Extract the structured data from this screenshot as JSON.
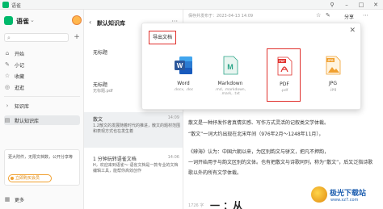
{
  "window": {
    "title": "语雀",
    "controls": [
      "⚲",
      "–",
      "□",
      "✕"
    ]
  },
  "sidebar": {
    "brand": "语雀",
    "brand_caret": "⌄",
    "search_icon": "search-icon",
    "add_label": "+",
    "nav": [
      {
        "label": "开始",
        "icon": "home-icon"
      },
      {
        "label": "小记",
        "icon": "note-icon"
      },
      {
        "label": "收藏",
        "icon": "star-icon"
      },
      {
        "label": "逛逛",
        "icon": "compass-icon"
      }
    ],
    "kb_section": "知识库",
    "kb_item": "默认知识库",
    "promo_text": "更大附件，无限文档数，公开分享等",
    "promo_button": "立即购买会员",
    "more": "更多"
  },
  "doclist": {
    "title": "默认知识库",
    "back": "‹",
    "dots": "···",
    "items": [
      {
        "title": "无标题",
        "sub": "",
        "time": "",
        "preview": ""
      },
      {
        "title": "无标题",
        "sub": "无标题.pdf",
        "time": "",
        "preview": ""
      },
      {
        "title": "散文",
        "sub": "",
        "time": "14:09",
        "preview": "1.2散文的发展随着时代的推进，散文的题材范围和表现方式也在发生着"
      },
      {
        "title": "1 分钟玩转语雀文档",
        "sub": "",
        "time": "14:06",
        "preview": "H，欢迎来到语雀～ 语雀文档是一款专业的文档编辑工具，能帮你高效创作"
      }
    ]
  },
  "editor": {
    "saved": "保存并发布于：2023-04-13 14:09",
    "share": "分享",
    "paragraphs": [
      "散文是一种抒发作者真情实感、写作方式灵活的记叙类文学体裁。",
      "“散文”一词大约出现在北宋年间（976年2月～1248年11月），",
      "《辨海》认为：中国六朝以来，为区别韵文与骈文，把凡不押韵，",
      "一词开始用于与韵文区别的文体。也有把散文与诗歌同列，称为“散文”，后又泛指诗歌",
      "歌以外的所有文学体裁。"
    ],
    "wordcount": "1726 字",
    "bigtext": "一 ：从"
  },
  "export_dialog": {
    "title": "导出文档",
    "close": "✕",
    "options": [
      {
        "label": "Word",
        "sub": ".docx, .doc",
        "icon": "word-icon",
        "selected": false
      },
      {
        "label": "Markdown",
        "sub": ".md, .markdown, .mark, .txt",
        "icon": "markdown-icon",
        "selected": false
      },
      {
        "label": "PDF",
        "sub": ".pdf",
        "icon": "pdf-icon",
        "selected": true
      },
      {
        "label": "JPG",
        "sub": ".jpg",
        "icon": "jpg-icon",
        "selected": false
      }
    ]
  },
  "watermark": {
    "name": "极光下载站",
    "url": "www.xz7.com"
  },
  "colors": {
    "brand": "#00b96b",
    "highlight": "#e0302c",
    "word": "#2b579a",
    "markdown": "#2ba588",
    "pdf": "#e0302c",
    "jpg": "#f0a030"
  }
}
